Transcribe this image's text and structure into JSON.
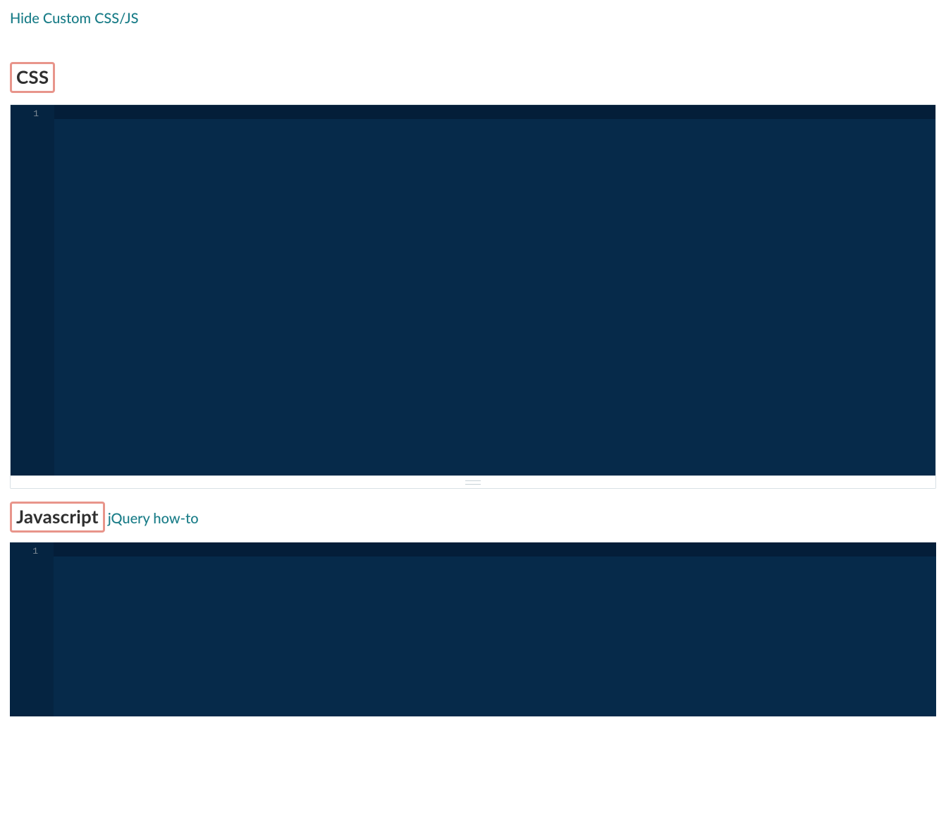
{
  "toggle_link_label": "Hide Custom CSS/JS",
  "css_section": {
    "heading": "CSS",
    "editor": {
      "line_numbers": [
        "1"
      ],
      "content": ""
    }
  },
  "js_section": {
    "heading": "Javascript",
    "help_link_label": "jQuery how-to",
    "editor": {
      "line_numbers": [
        "1"
      ],
      "content": ""
    }
  }
}
